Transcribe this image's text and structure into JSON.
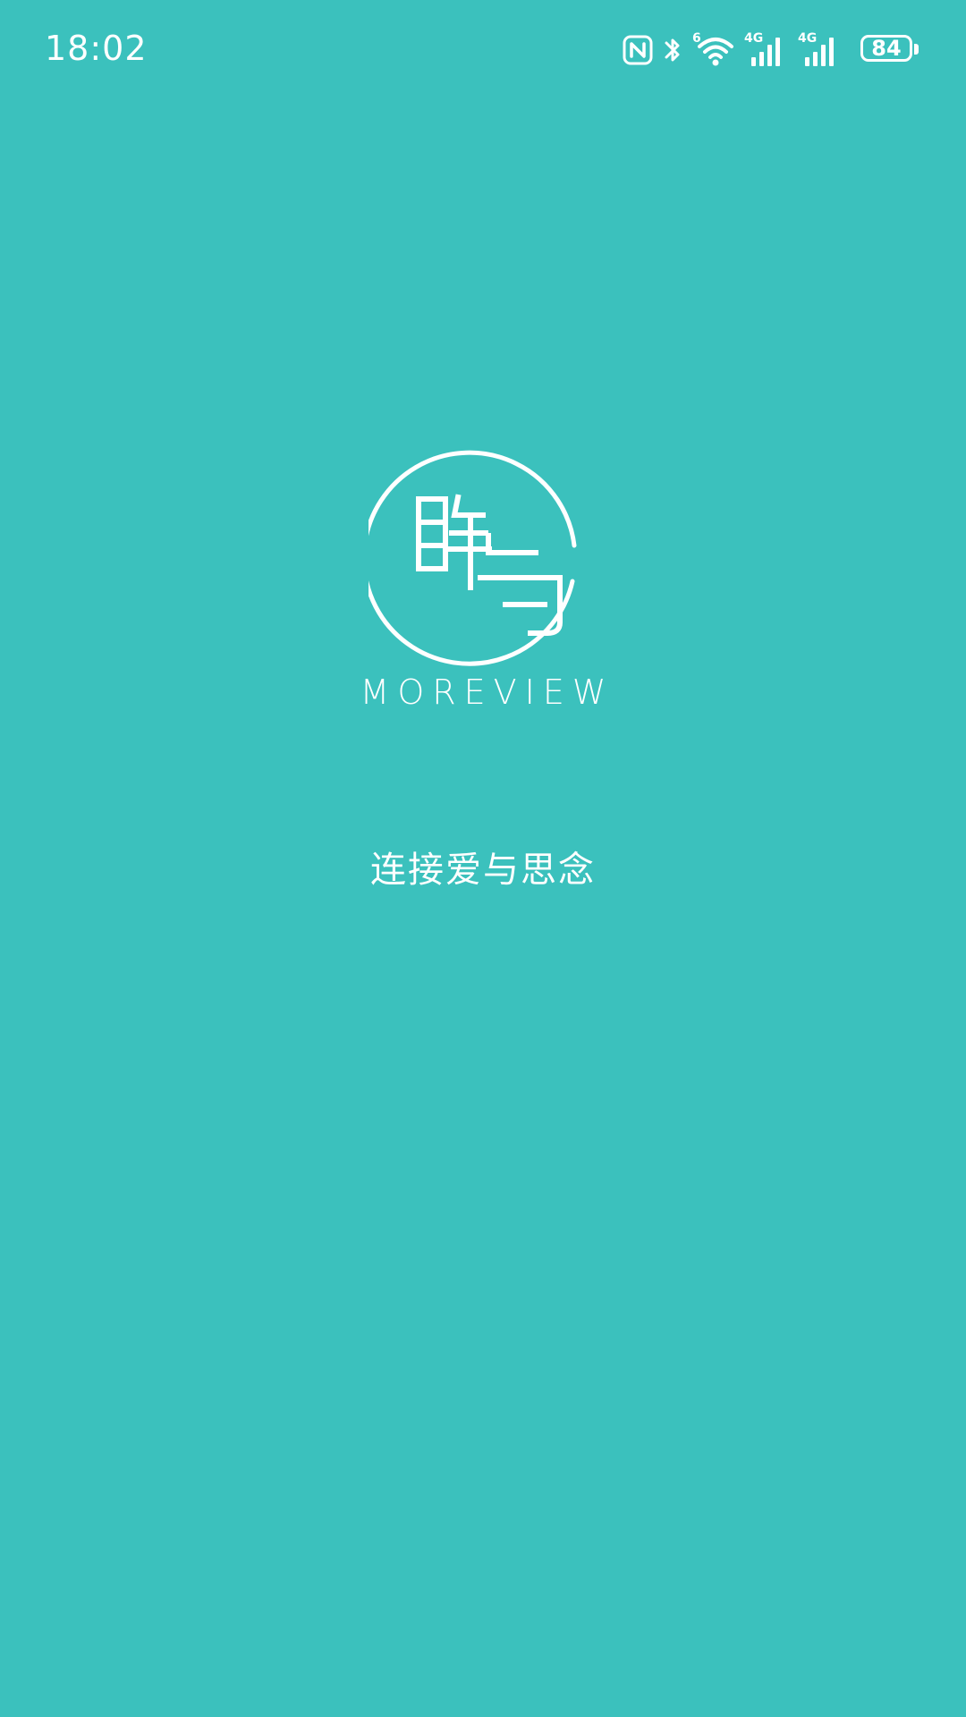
{
  "status_bar": {
    "time": "18:02",
    "wifi_badge": "6",
    "sim1_network": "4G",
    "sim2_network": "4G",
    "battery_level": "84",
    "icons": [
      "nfc-icon",
      "bluetooth-icon",
      "wifi-icon",
      "signal-icon",
      "signal-icon",
      "battery-icon"
    ]
  },
  "splash": {
    "logo_glyphs": "眸与",
    "brand_name": "MOREVIEW",
    "tagline": "连接爱与思念"
  },
  "colors": {
    "background": "#3bc1bd",
    "foreground": "#ffffff"
  }
}
